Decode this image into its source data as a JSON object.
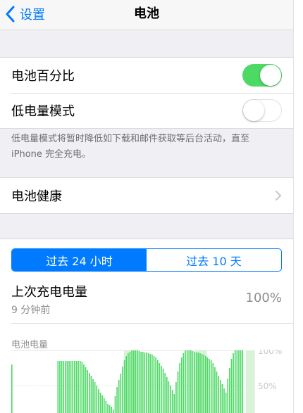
{
  "nav": {
    "back_label": "设置",
    "title": "电池"
  },
  "settings": {
    "battery_percentage": {
      "label": "电池百分比",
      "on": true
    },
    "low_power_mode": {
      "label": "低电量模式",
      "on": false
    },
    "footnote_line1": "低电量模式将暂时降低如下载和邮件获取等后台活动，直至",
    "footnote_line2": "iPhone 完全充电。",
    "battery_health": {
      "label": "电池健康"
    }
  },
  "segmented": {
    "options": [
      "过去 24 小时",
      "过去 10 天"
    ],
    "selected": 0
  },
  "last_charge": {
    "title": "上次充电电量",
    "time": "9 分钟前",
    "level": "100%"
  },
  "chart_title": "电池电量",
  "chart_data": {
    "type": "bar",
    "title": "电池电量",
    "y_tick_labels": [
      "100%",
      "50%"
    ],
    "ylim": [
      0,
      100
    ],
    "colors": {
      "bar": "#4cd964",
      "charging": "#d9f2d9",
      "grid": "#e3e3e3",
      "tick_label": "#c7c7cc"
    },
    "values": [
      80,
      0,
      0,
      0,
      0,
      0,
      0,
      0,
      0,
      0,
      0,
      0,
      0,
      0,
      0,
      0,
      0,
      0,
      0,
      0,
      0,
      0,
      0,
      0,
      0,
      85,
      85,
      85,
      85,
      85,
      85,
      85,
      85,
      85,
      85,
      85,
      85,
      85,
      84,
      80,
      76,
      72,
      68,
      64,
      59,
      55,
      50,
      45,
      40,
      36,
      32,
      28,
      24,
      22,
      20,
      16,
      35,
      48,
      58,
      67,
      77,
      86,
      92,
      96,
      98,
      100,
      100,
      100,
      100,
      99,
      98,
      98,
      97,
      97,
      96,
      95,
      94,
      92,
      90,
      86,
      82,
      78,
      74,
      68,
      62,
      56,
      50,
      44,
      38,
      55,
      70,
      82,
      90,
      96,
      100,
      100,
      100,
      100,
      99,
      98,
      97,
      97,
      96,
      95,
      94,
      92,
      90,
      88,
      86,
      82,
      76,
      70,
      64,
      58,
      52,
      46,
      40,
      60,
      75,
      88,
      96,
      100,
      100,
      100,
      100,
      100
    ],
    "charging_ranges": [
      [
        61,
        68
      ],
      [
        99,
        105
      ],
      [
        127,
        131
      ]
    ]
  }
}
